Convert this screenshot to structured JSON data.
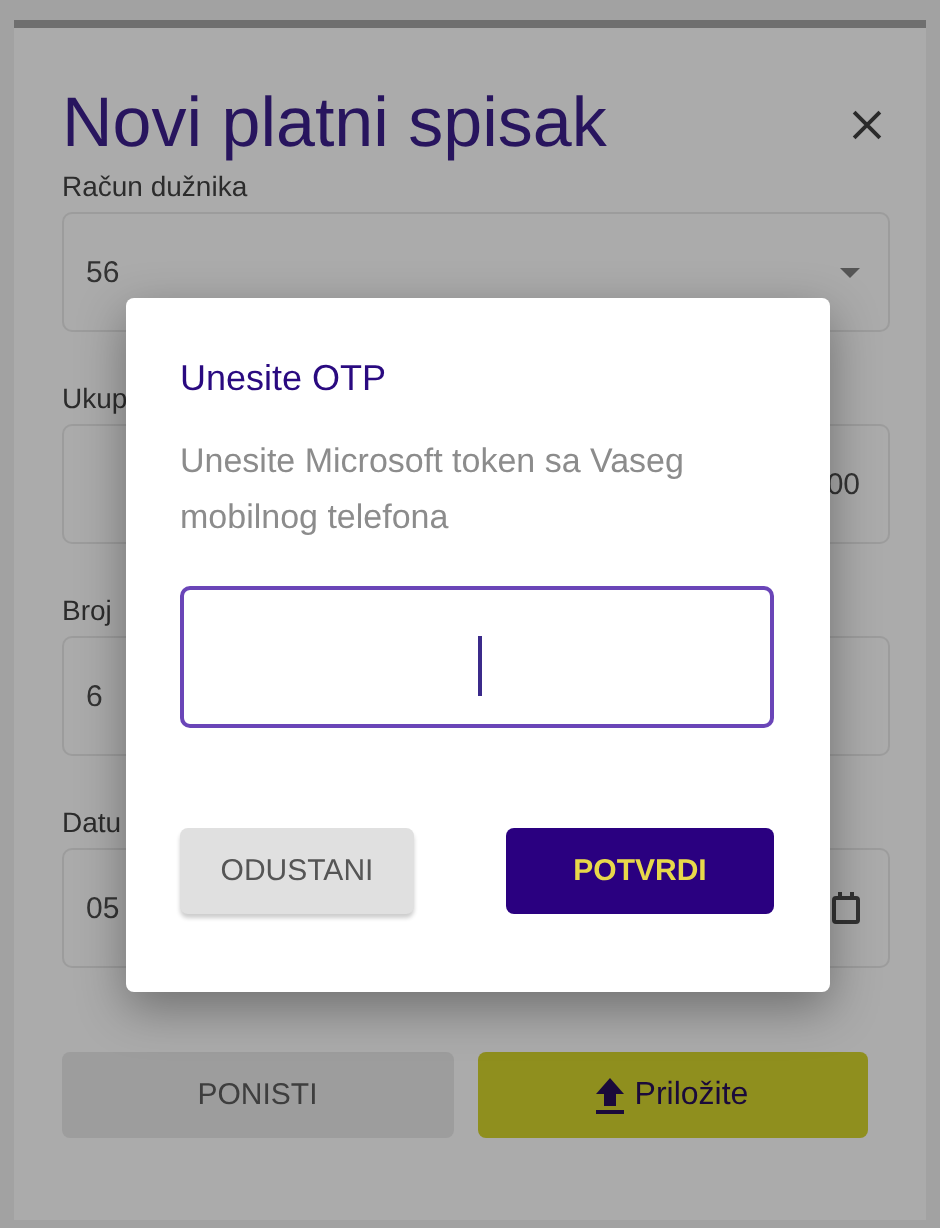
{
  "form": {
    "title": "Novi platni spisak",
    "fields": [
      {
        "kind": "select",
        "label": "Račun dužnika",
        "value": "56"
      },
      {
        "kind": "amount",
        "label": "Ukup",
        "value": "00"
      },
      {
        "kind": "text",
        "label": "Broj",
        "value": "6"
      },
      {
        "kind": "date",
        "label": "Datu",
        "value": "05"
      }
    ],
    "buttons": [
      {
        "kind": "secondary",
        "label": "PONISTI"
      },
      {
        "kind": "upload",
        "label": "Priložite"
      }
    ]
  },
  "dialog": {
    "title": "Unesite OTP",
    "message": "Unesite Microsoft token sa Vaseg mobilnog telefona",
    "input": {
      "focused": true
    },
    "buttons": [
      {
        "kind": "secondary",
        "label": "ODUSTANI"
      },
      {
        "kind": "primary",
        "label": "POTVRDI"
      }
    ]
  }
}
